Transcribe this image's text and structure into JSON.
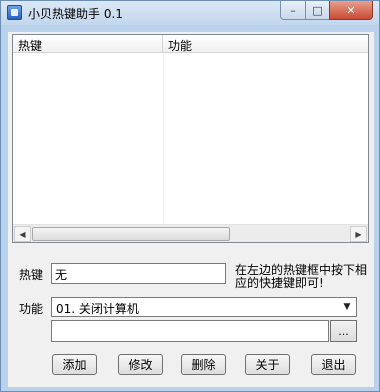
{
  "window": {
    "title": "小贝热键助手 0.1",
    "minimize_glyph": "–",
    "maximize_glyph": "□",
    "close_glyph": "✕"
  },
  "list": {
    "columns": [
      "热键",
      "功能"
    ],
    "rows": []
  },
  "form": {
    "hotkey_label": "热键",
    "hotkey_value": "无",
    "hint": "在左边的热键框中按下相应的快捷键即可!",
    "function_label": "功能",
    "function_selected": "01. 关闭计算机",
    "path_value": "",
    "browse_label": "..."
  },
  "buttons": {
    "add": "添加",
    "edit": "修改",
    "delete": "删除",
    "about": "关于",
    "exit": "退出"
  },
  "icons": {
    "app": "app-icon",
    "scroll_left": "◀",
    "scroll_right": "▶",
    "dropdown": "▼"
  }
}
